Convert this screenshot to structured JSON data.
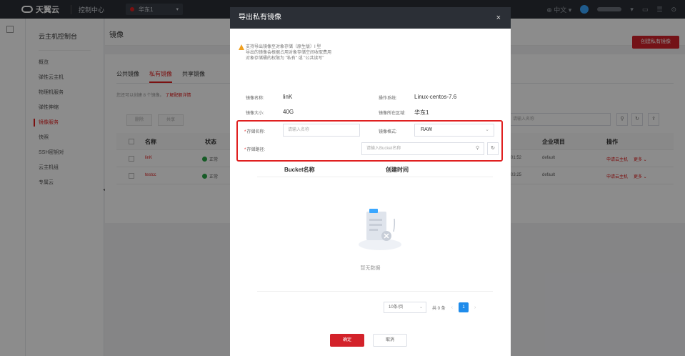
{
  "topbar": {
    "brand": "天翼云",
    "nav_label": "控制中心",
    "region": "华东1",
    "lang": "中文"
  },
  "sidebar": {
    "title": "云主机控制台",
    "items": [
      {
        "label": "概览",
        "active": false
      },
      {
        "label": "弹性云主机",
        "active": false
      },
      {
        "label": "物理机服务",
        "active": false
      },
      {
        "label": "弹性伸缩",
        "active": false
      },
      {
        "label": "镜像服务",
        "active": true
      },
      {
        "label": "快照",
        "active": false
      },
      {
        "label": "SSH密钥对",
        "active": false
      },
      {
        "label": "云主机组",
        "active": false
      },
      {
        "label": "专属云",
        "active": false
      }
    ]
  },
  "main": {
    "title": "镜像",
    "create_button": "创建私有镜像",
    "tabs": [
      {
        "label": "公共镜像",
        "active": false
      },
      {
        "label": "私有镜像",
        "active": true
      },
      {
        "label": "共享镜像",
        "active": false
      }
    ],
    "hint": "您还可以创建 8 个镜像。",
    "hint_link": "了解配额详情",
    "delete_button": "删除",
    "share_button": "共享",
    "search_placeholder": "请输入名称",
    "columns": {
      "name": "名称",
      "status": "状态",
      "project": "企业项目",
      "action": "操作"
    },
    "rows": [
      {
        "name": "linK",
        "status": "正常",
        "time": "01:52",
        "project": "default",
        "action_apply": "申请云主机",
        "action_more": "更多"
      },
      {
        "name": "testcc",
        "status": "正常",
        "time": "03:25",
        "project": "default",
        "action_apply": "申请云主机",
        "action_more": "更多"
      }
    ]
  },
  "modal": {
    "title": "导出私有镜像",
    "close": "×",
    "warning_lines": [
      "支持导出镜像至对象存储（原生版）I 型",
      "导出的镜像会根据占用对象存储空间收取费用",
      "对象存储桶的权限为 \"私有\" 或 \"公共读写\""
    ],
    "image_name_label": "镜像名称:",
    "image_name_value": "linK",
    "os_label": "操作系统:",
    "os_value": "Linux-centos-7.6",
    "size_label": "镜像大小:",
    "size_value": "40G",
    "region_label": "镜像所在区域:",
    "region_value": "华东1",
    "storage_name_label": "存储名称:",
    "storage_name_placeholder": "请输入名称",
    "format_label": "镜像格式:",
    "format_value": "RAW",
    "storage_path_label": "存储路径:",
    "storage_path_placeholder": "请输入Bucket名称",
    "bucket_col_name": "Bucket名称",
    "bucket_col_time": "创建时间",
    "empty_text": "暂无数据",
    "pager_size": "10条/页",
    "pager_total": "共 0 条",
    "pager_current": "1",
    "confirm_button": "确定",
    "cancel_button": "取消"
  },
  "colors": {
    "accent": "#d3222a",
    "topbar": "#2b2f36",
    "pager_active": "#1f8ceb",
    "highlight": "#e02020"
  }
}
